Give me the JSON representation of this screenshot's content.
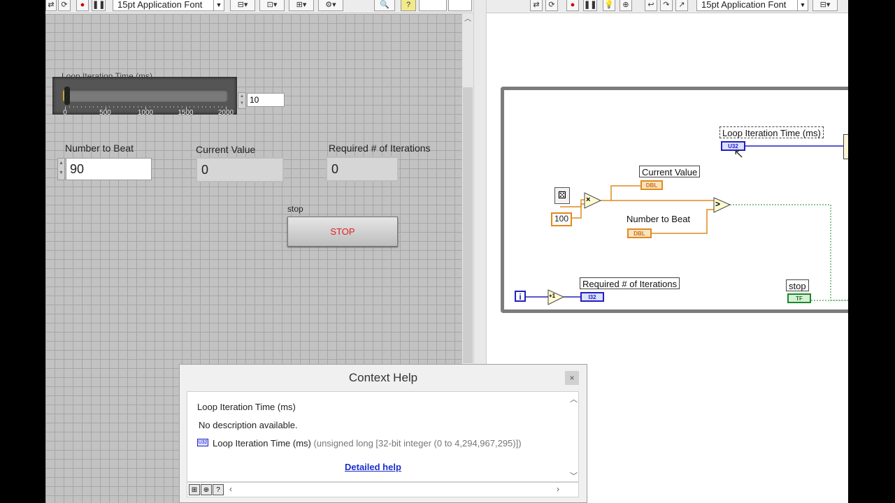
{
  "front_panel": {
    "toolbar": {
      "font_select": "15pt Application Font",
      "right_box_value": ""
    },
    "slider": {
      "label": "Loop Iteration Time (ms)",
      "ticks": [
        "0",
        "500",
        "1000",
        "1500",
        "2000"
      ],
      "value": "10",
      "fraction": 0.005
    },
    "number_to_beat": {
      "label": "Number to Beat",
      "value": "90"
    },
    "current_value": {
      "label": "Current Value",
      "value": "0"
    },
    "required_iterations": {
      "label": "Required # of Iterations",
      "value": "0"
    },
    "stop": {
      "label": "stop",
      "button_text": "STOP"
    }
  },
  "block_diagram": {
    "toolbar": {
      "font_select": "15pt Application Font"
    },
    "labels": {
      "loop_iteration_time": "Loop Iteration Time (ms)",
      "current_value": "Current Value",
      "number_to_beat": "Number to Beat",
      "required_iterations": "Required # of Iterations",
      "stop": "stop"
    },
    "terminals": {
      "u32": "U32",
      "dbl1": "DBL",
      "dbl2": "DBL",
      "i32": "I32",
      "tf": "TF",
      "constant_100": "100",
      "iteration": "i",
      "increment": "+1",
      "multiply": "×",
      "greater": ">"
    }
  },
  "context_help": {
    "title": "Context Help",
    "close": "×",
    "name": "Loop Iteration Time (ms)",
    "description": "No description available.",
    "type_name": "Loop Iteration Time (ms)",
    "type_detail": "(unsigned long [32-bit integer (0 to 4,294,967,295)])",
    "type_badge": "U32",
    "link": "Detailed help"
  },
  "colors": {
    "orange_wire": "#e08a1e",
    "blue_wire": "#2020c0",
    "green_wire": "#1a8a2a",
    "stop_text": "#e02020"
  }
}
